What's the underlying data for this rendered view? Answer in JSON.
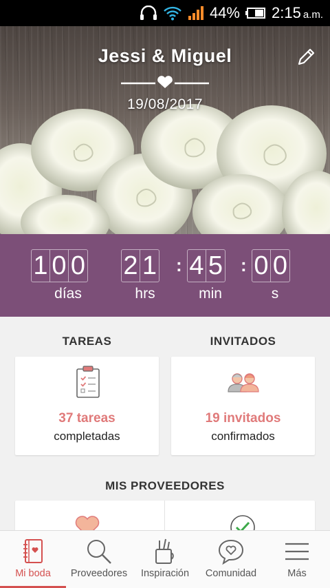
{
  "status_bar": {
    "battery_percent": "44%",
    "time": "2:15",
    "ampm": "a.m."
  },
  "hero": {
    "couple_names": "Jessi & Miguel",
    "wedding_date": "19/08/2017"
  },
  "countdown": {
    "days": [
      "1",
      "0",
      "0"
    ],
    "hours": [
      "2",
      "1"
    ],
    "minutes": [
      "4",
      "5"
    ],
    "seconds": [
      "0",
      "0"
    ],
    "days_label": "días",
    "hours_label": "hrs",
    "minutes_label": "min",
    "seconds_label": "s"
  },
  "tasks": {
    "title": "TAREAS",
    "count_text": "37 tareas",
    "sub_text": "completadas"
  },
  "guests": {
    "title": "INVITADOS",
    "count_text": "19 invitados",
    "sub_text": "confirmados"
  },
  "vendors": {
    "title": "MIS PROVEEDORES"
  },
  "nav": {
    "items": [
      {
        "label": "Mi boda",
        "icon": "notebook-icon",
        "active": true
      },
      {
        "label": "Proveedores",
        "icon": "search-icon",
        "active": false
      },
      {
        "label": "Inspiración",
        "icon": "pencil-cup-icon",
        "active": false
      },
      {
        "label": "Comunidad",
        "icon": "chat-heart-icon",
        "active": false
      },
      {
        "label": "Más",
        "icon": "menu-icon",
        "active": false
      }
    ]
  },
  "colors": {
    "accent": "#d4504f",
    "countdown_bg": "#7c4f78",
    "highlight_text": "#e07a7a"
  }
}
